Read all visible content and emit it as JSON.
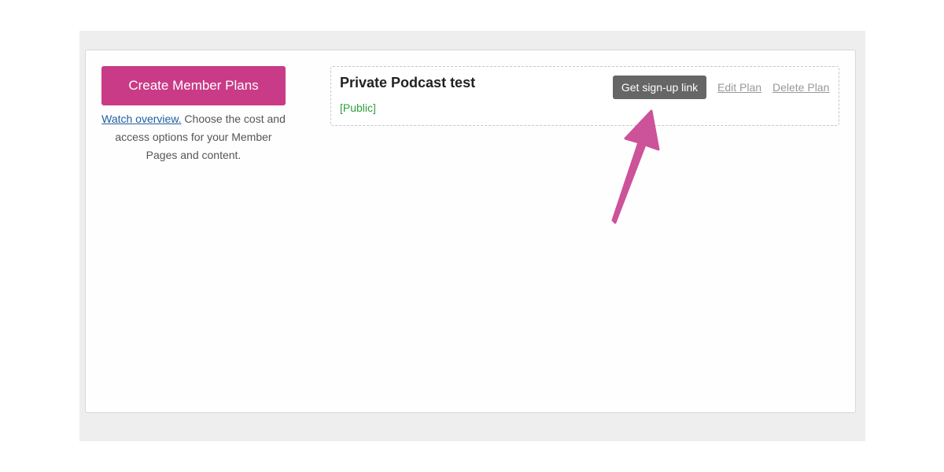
{
  "sidebar": {
    "create_button_label": "Create Member Plans",
    "help_link_text": "Watch overview.",
    "help_text": " Choose the cost and access options for your Member Pages and content."
  },
  "plans": [
    {
      "title": "Private Podcast test",
      "status": "[Public]",
      "signup_button_label": "Get sign-up link",
      "edit_label": "Edit Plan",
      "delete_label": "Delete Plan"
    }
  ],
  "colors": {
    "brand_pink": "#c93b86",
    "status_green": "#2f9e3c",
    "annotation_arrow": "#cc5299"
  },
  "annotation": {
    "icon": "pointer-arrow-icon"
  }
}
